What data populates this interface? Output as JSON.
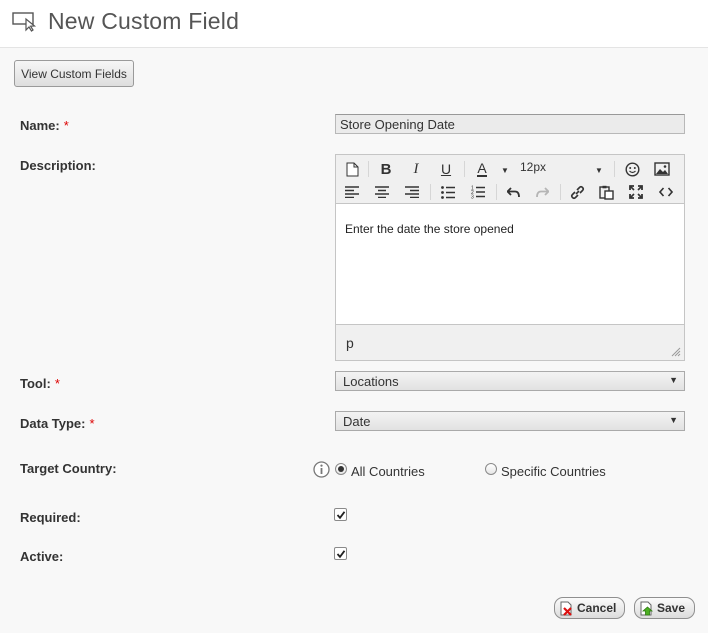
{
  "header": {
    "title": "New Custom Field",
    "icon": "custom-field-icon"
  },
  "view_button_label": "View Custom Fields",
  "form": {
    "name": {
      "label": "Name:",
      "value": "Store Opening Date",
      "required_mark": "*"
    },
    "description": {
      "label": "Description:",
      "font_size": "12px",
      "content": "Enter the date the store opened",
      "status_path": "p"
    },
    "tool": {
      "label": "Tool:",
      "required_mark": "*",
      "selected": "Locations"
    },
    "data_type": {
      "label": "Data Type:",
      "required_mark": "*",
      "selected": "Date"
    },
    "target_country": {
      "label": "Target Country:",
      "options": [
        "All Countries",
        "Specific Countries"
      ],
      "selected": "All Countries"
    },
    "required": {
      "label": "Required:",
      "checked": true
    },
    "active": {
      "label": "Active:",
      "checked": true
    }
  },
  "actions": {
    "cancel_label": "Cancel",
    "save_label": "Save"
  },
  "colors": {
    "required_mark": "#dd0000",
    "page_background": "#f8f8f8"
  }
}
